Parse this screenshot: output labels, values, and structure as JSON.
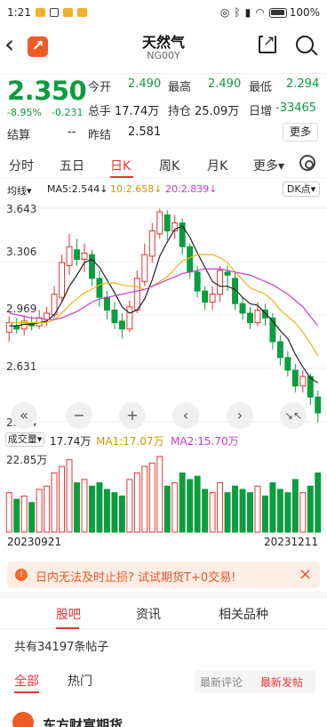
{
  "status": {
    "time": "1:21",
    "battery": "100%"
  },
  "header": {
    "title": "天然气",
    "code": "NG00Y"
  },
  "quote": {
    "price": "2.350",
    "change_pct": "-8.95%",
    "change": "-0.231",
    "open_label": "今开",
    "open": "2.490",
    "high_label": "最高",
    "high": "2.490",
    "low_label": "最低",
    "low": "2.294",
    "volume_label": "总手",
    "volume": "17.74万",
    "oi_label": "持仓",
    "oi": "25.09万",
    "daily_add_label": "日增",
    "daily_add": "-33465",
    "settle_label": "结算",
    "settle": "--",
    "prev_settle_label": "昨结",
    "prev_settle": "2.581",
    "more_label": "更多"
  },
  "tabs": [
    "分时",
    "五日",
    "日K",
    "周K",
    "月K",
    "更多▾"
  ],
  "ma_bar": {
    "selector": "均线▾",
    "ma5": "MA5:2.544↓",
    "ma10": "10:2.658↓",
    "ma20": "20:2.839↓",
    "dk": "DK点▾"
  },
  "axis": {
    "y1": "3.643",
    "y2": "3.306",
    "y3": "2.969",
    "y4": "2.631",
    "y5": "2.294"
  },
  "controls": [
    "«",
    "−",
    "+",
    "‹",
    "›",
    "↘↖"
  ],
  "volume_bar": {
    "selector": "成交量▾",
    "vol": "17.74万",
    "ma1": "MA1:17.07万",
    "ma2": "MA2:15.70万",
    "max": "22.85万"
  },
  "dates": {
    "start": "20230921",
    "end": "20231211"
  },
  "banner": {
    "text": "日内无法及时止损? 试试期货T+0交易!",
    "icon": "!",
    "close": "×"
  },
  "subtabs": [
    "股吧",
    "资讯",
    "相关品种"
  ],
  "posts": {
    "count_text": "共有34197条帖子"
  },
  "filters": {
    "all": "全部",
    "hot": "热门",
    "latest_reply": "最新评论",
    "latest_post": "最新发帖"
  },
  "post_preview": {
    "author": "东方财富期货"
  },
  "colors": {
    "up": "#e33333",
    "down": "#0b9d3f",
    "ma5": "#222222",
    "ma10": "#e7b416",
    "ma20": "#c93bc9"
  },
  "chart_data": {
    "type": "candlestick",
    "y_range": [
      2.294,
      3.643
    ],
    "candles": [
      [
        2.86,
        2.92,
        2.96,
        2.8
      ],
      [
        2.9,
        2.88,
        2.95,
        2.85
      ],
      [
        2.88,
        2.93,
        2.97,
        2.84
      ],
      [
        2.92,
        2.9,
        2.96,
        2.87
      ],
      [
        2.9,
        2.95,
        3.0,
        2.88
      ],
      [
        2.94,
        2.98,
        3.02,
        2.9
      ],
      [
        2.97,
        3.1,
        3.15,
        2.95
      ],
      [
        3.08,
        3.3,
        3.35,
        3.05
      ],
      [
        3.28,
        3.4,
        3.48,
        3.22
      ],
      [
        3.38,
        3.32,
        3.45,
        3.28
      ],
      [
        3.32,
        3.36,
        3.42,
        3.24
      ],
      [
        3.35,
        3.2,
        3.38,
        3.15
      ],
      [
        3.2,
        3.08,
        3.25,
        3.02
      ],
      [
        3.08,
        3.0,
        3.12,
        2.94
      ],
      [
        3.0,
        2.92,
        3.05,
        2.88
      ],
      [
        2.93,
        2.88,
        2.98,
        2.82
      ],
      [
        2.88,
        3.02,
        3.06,
        2.86
      ],
      [
        3.0,
        3.2,
        3.25,
        2.98
      ],
      [
        3.18,
        3.35,
        3.42,
        3.15
      ],
      [
        3.34,
        3.5,
        3.55,
        3.3
      ],
      [
        3.48,
        3.62,
        3.64,
        3.45
      ],
      [
        3.6,
        3.5,
        3.63,
        3.44
      ],
      [
        3.5,
        3.55,
        3.6,
        3.45
      ],
      [
        3.55,
        3.4,
        3.58,
        3.35
      ],
      [
        3.4,
        3.24,
        3.42,
        3.2
      ],
      [
        3.24,
        3.12,
        3.28,
        3.08
      ],
      [
        3.12,
        3.05,
        3.15,
        3.0
      ],
      [
        3.05,
        3.1,
        3.15,
        3.0
      ],
      [
        3.1,
        3.25,
        3.28,
        3.05
      ],
      [
        3.24,
        3.22,
        3.28,
        3.12
      ],
      [
        3.2,
        3.04,
        3.24,
        3.0
      ],
      [
        3.04,
        2.98,
        3.08,
        2.94
      ],
      [
        2.98,
        2.92,
        3.02,
        2.88
      ],
      [
        2.92,
        3.0,
        3.05,
        2.9
      ],
      [
        3.0,
        2.95,
        3.04,
        2.9
      ],
      [
        2.95,
        2.8,
        2.98,
        2.75
      ],
      [
        2.8,
        2.7,
        2.84,
        2.65
      ],
      [
        2.7,
        2.62,
        2.74,
        2.58
      ],
      [
        2.62,
        2.52,
        2.66,
        2.48
      ],
      [
        2.52,
        2.58,
        2.62,
        2.48
      ],
      [
        2.58,
        2.45,
        2.6,
        2.4
      ],
      [
        2.45,
        2.35,
        2.49,
        2.29
      ]
    ],
    "ma5": [
      2.9,
      2.9,
      2.91,
      2.91,
      2.92,
      2.93,
      2.97,
      3.05,
      3.15,
      3.22,
      3.3,
      3.32,
      3.27,
      3.19,
      3.11,
      3.02,
      2.98,
      3.0,
      3.07,
      3.19,
      3.34,
      3.43,
      3.51,
      3.53,
      3.46,
      3.36,
      3.27,
      3.18,
      3.15,
      3.15,
      3.13,
      3.08,
      3.04,
      3.03,
      2.98,
      2.93,
      2.87,
      2.82,
      2.72,
      2.64,
      2.57,
      2.54
    ],
    "ma10": [
      2.92,
      2.92,
      2.92,
      2.92,
      2.92,
      2.92,
      2.94,
      2.98,
      3.03,
      3.07,
      3.11,
      3.13,
      3.16,
      3.17,
      3.17,
      3.16,
      3.15,
      3.15,
      3.13,
      3.15,
      3.18,
      3.21,
      3.26,
      3.31,
      3.33,
      3.35,
      3.35,
      3.35,
      3.33,
      3.3,
      3.24,
      3.19,
      3.14,
      3.12,
      3.1,
      3.06,
      3.0,
      2.96,
      2.92,
      2.86,
      2.79,
      2.71
    ],
    "ma20": [
      2.98,
      2.97,
      2.96,
      2.95,
      2.95,
      2.94,
      2.94,
      2.95,
      2.97,
      2.99,
      3.02,
      3.05,
      3.07,
      3.08,
      3.09,
      3.1,
      3.11,
      3.12,
      3.13,
      3.15,
      3.17,
      3.19,
      3.21,
      3.23,
      3.24,
      3.25,
      3.26,
      3.26,
      3.26,
      3.25,
      3.24,
      3.23,
      3.22,
      3.2,
      3.18,
      3.16,
      3.13,
      3.1,
      3.06,
      3.02,
      2.96,
      2.9
    ],
    "volumes": [
      12,
      10,
      11,
      9,
      13,
      14,
      18,
      20,
      22,
      15,
      16,
      14,
      15,
      13,
      12,
      11,
      16,
      18,
      20,
      21,
      23,
      14,
      15,
      18,
      16,
      17,
      13,
      12,
      15,
      12,
      14,
      13,
      12,
      14,
      11,
      15,
      13,
      12,
      16,
      12,
      14,
      18
    ]
  }
}
